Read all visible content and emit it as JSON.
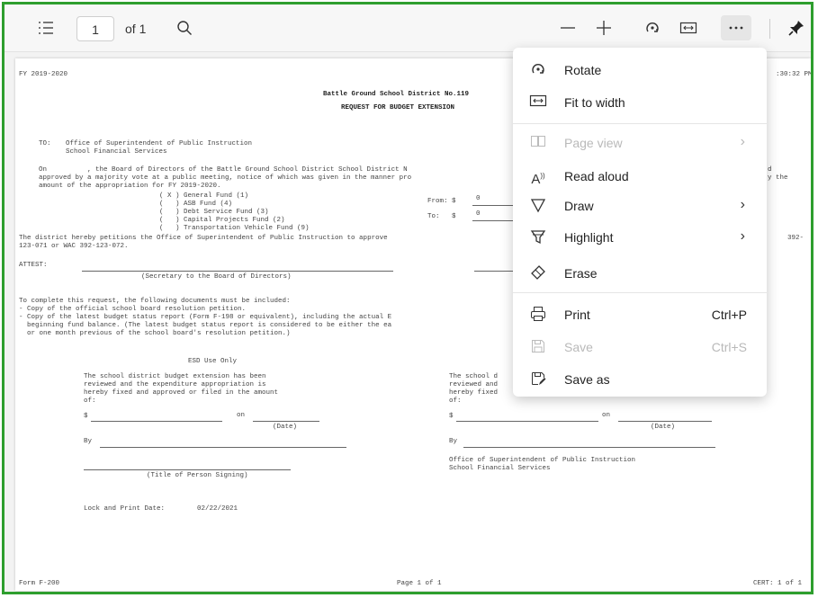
{
  "toolbar": {
    "page_number": "1",
    "page_of": "of 1",
    "icons": [
      "contents-icon",
      "search-icon",
      "zoom-out-icon",
      "zoom-in-icon",
      "rotate-icon",
      "fit-width-icon",
      "more-icon",
      "pin-icon"
    ]
  },
  "menu": {
    "rotate": "Rotate",
    "fit_to_width": "Fit to width",
    "page_view": "Page view",
    "read_aloud": "Read aloud",
    "draw": "Draw",
    "highlight": "Highlight",
    "erase": "Erase",
    "print": "Print",
    "print_shortcut": "Ctrl+P",
    "save": "Save",
    "save_shortcut": "Ctrl+S",
    "save_as": "Save as"
  },
  "document": {
    "fy": "FY 2019-2020",
    "time": ":30:32 PM",
    "district": "Battle Ground School District No.119",
    "heading": "REQUEST FOR BUDGET EXTENSION",
    "to_label": "TO:",
    "to_line1": "Office of Superintendent of Public Instruction",
    "to_line2": "School Financial Services",
    "para1": "On          , the Board of Directors of the Battle Ground School District School District N",
    "para2": "approved by a majority vote at a public meeting, notice of which was given in the manner pro",
    "para3": "amount of the appropriation for FY 2019-2020.",
    "para_right1": "d",
    "para_right2": "y the",
    "fund1": "( X ) General Fund (1)",
    "fund2": "(   ) ASB Fund (4)",
    "fund3": "(   ) Debt Service Fund (3)",
    "fund4": "(   ) Capital Projects Fund (2)",
    "fund5": "(   ) Transportation Vehicle Fund (9)",
    "from_label": "From: $",
    "from_value": "0",
    "to_amount_label": "To:   $",
    "to_amount_value": "0",
    "petition1": "The district hereby petitions the Office of Superintendent of Public Instruction to approve",
    "petition2": "123-071 or WAC 392-123-072.",
    "petition_right": "392-",
    "attest": "ATTEST:",
    "secretary": "(Secretary to the Board of Directors)",
    "complete1": "To complete this request, the following documents must be included:",
    "complete2": "- Copy of the official school board resolution petition.",
    "complete3": "- Copy of the latest budget status report (Form F-198 or equivalent), including the actual E",
    "complete4": "  beginning fund balance. (The latest budget status report is considered to be either the ea",
    "complete5": "  or one month previous of the school board's resolution petition.)",
    "esd": "ESD Use Only",
    "esd_p1": "The school district budget extension has been",
    "esd_p2": "reviewed and the expenditure appropriation is",
    "esd_p3": "hereby fixed and approved or filed in the amount",
    "esd_p4": "of:",
    "dollar": "$",
    "on": "on",
    "date": "(Date)",
    "by": "By",
    "title_signing": "(Title of Person Signing)",
    "lock_label": "Lock and Print Date:",
    "lock_date": "02/22/2021",
    "ospi_p1": "The school d",
    "ospi_p2": "reviewed and",
    "ospi_p3": "hereby fixed",
    "ospi_p4": "of:",
    "ospi_office1": "Office of Superintendent of Public Instruction",
    "ospi_office2": "School Financial Services",
    "footer_form": "Form F-200",
    "footer_page": "Page 1 of 1",
    "footer_cert": "CERT: 1 of 1"
  }
}
